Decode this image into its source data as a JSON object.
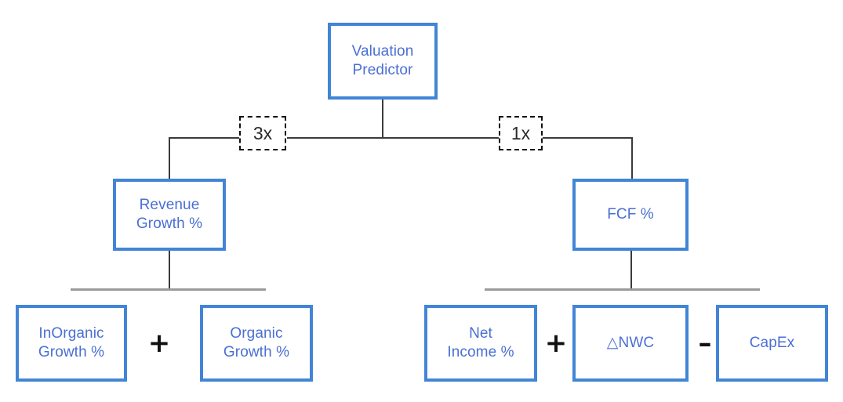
{
  "diagram": {
    "title_node": {
      "label": "Valuation\nPredictor"
    },
    "multipliers": [
      {
        "name": "revenue-multiplier",
        "label": "3x"
      },
      {
        "name": "fcf-multiplier",
        "label": "1x"
      }
    ],
    "level2": [
      {
        "name": "revenue-growth",
        "label": "Revenue\nGrowth %"
      },
      {
        "name": "fcf",
        "label": "FCF %"
      }
    ],
    "level3": [
      {
        "name": "inorganic-growth",
        "label": "InOrganic\nGrowth %"
      },
      {
        "name": "organic-growth",
        "label": "Organic\nGrowth %"
      },
      {
        "name": "net-income",
        "label": "Net\nIncome %"
      },
      {
        "name": "delta-nwc",
        "label": "△NWC"
      },
      {
        "name": "capex",
        "label": "CapEx"
      }
    ],
    "operators": [
      {
        "name": "plus-operator-left",
        "label": "+"
      },
      {
        "name": "plus-operator-right",
        "label": "+"
      },
      {
        "name": "minus-operator",
        "label": "–"
      }
    ],
    "colors": {
      "box_border": "#4285d6",
      "box_text": "#4a6fd4",
      "connector": "#3b3b3b",
      "distribution_bar": "#9a9a9a",
      "operator": "#111111",
      "multiplier_border": "#111111",
      "background": "#ffffff"
    }
  }
}
